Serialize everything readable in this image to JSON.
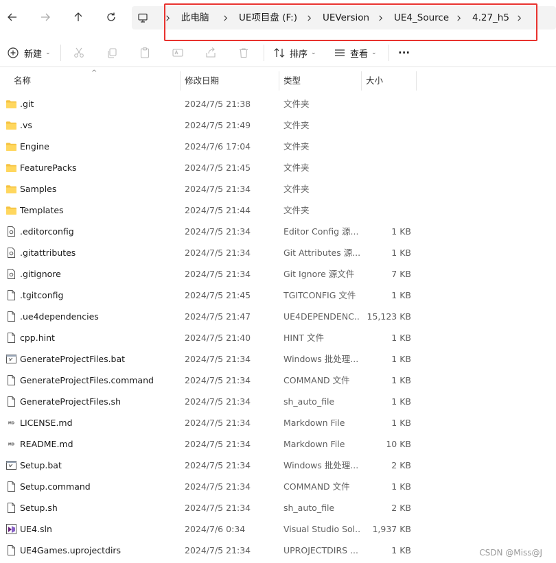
{
  "nav": {
    "back_icon": "arrow-left-icon",
    "forward_icon": "arrow-right-icon",
    "up_icon": "arrow-up-icon",
    "refresh_icon": "refresh-icon",
    "computer_icon": "computer-icon"
  },
  "breadcrumb": [
    "此电脑",
    "UE项目盘 (F:)",
    "UEVersion",
    "UE4_Source",
    "4.27_h5"
  ],
  "toolbar": {
    "new_label": "新建",
    "sort_label": "排序",
    "view_label": "查看",
    "more_label": "···"
  },
  "columns": {
    "name": "名称",
    "date": "修改日期",
    "type": "类型",
    "size": "大小"
  },
  "files": [
    {
      "name": ".git",
      "date": "2024/7/5 21:38",
      "type": "文件夹",
      "size": "",
      "icon": "folder"
    },
    {
      "name": ".vs",
      "date": "2024/7/5 21:49",
      "type": "文件夹",
      "size": "",
      "icon": "folder"
    },
    {
      "name": "Engine",
      "date": "2024/7/6 17:04",
      "type": "文件夹",
      "size": "",
      "icon": "folder"
    },
    {
      "name": "FeaturePacks",
      "date": "2024/7/5 21:45",
      "type": "文件夹",
      "size": "",
      "icon": "folder"
    },
    {
      "name": "Samples",
      "date": "2024/7/5 21:34",
      "type": "文件夹",
      "size": "",
      "icon": "folder"
    },
    {
      "name": "Templates",
      "date": "2024/7/5 21:44",
      "type": "文件夹",
      "size": "",
      "icon": "folder"
    },
    {
      "name": ".editorconfig",
      "date": "2024/7/5 21:34",
      "type": "Editor Config 源...",
      "size": "1 KB",
      "icon": "config"
    },
    {
      "name": ".gitattributes",
      "date": "2024/7/5 21:34",
      "type": "Git Attributes 源...",
      "size": "1 KB",
      "icon": "config"
    },
    {
      "name": ".gitignore",
      "date": "2024/7/5 21:34",
      "type": "Git Ignore 源文件",
      "size": "7 KB",
      "icon": "config"
    },
    {
      "name": ".tgitconfig",
      "date": "2024/7/5 21:45",
      "type": "TGITCONFIG 文件",
      "size": "1 KB",
      "icon": "file"
    },
    {
      "name": ".ue4dependencies",
      "date": "2024/7/5 21:47",
      "type": "UE4DEPENDENC...",
      "size": "15,123 KB",
      "icon": "file"
    },
    {
      "name": "cpp.hint",
      "date": "2024/7/5 21:40",
      "type": "HINT 文件",
      "size": "1 KB",
      "icon": "file"
    },
    {
      "name": "GenerateProjectFiles.bat",
      "date": "2024/7/5 21:34",
      "type": "Windows 批处理...",
      "size": "1 KB",
      "icon": "batch"
    },
    {
      "name": "GenerateProjectFiles.command",
      "date": "2024/7/5 21:34",
      "type": "COMMAND 文件",
      "size": "1 KB",
      "icon": "file"
    },
    {
      "name": "GenerateProjectFiles.sh",
      "date": "2024/7/5 21:34",
      "type": "sh_auto_file",
      "size": "1 KB",
      "icon": "file"
    },
    {
      "name": "LICENSE.md",
      "date": "2024/7/5 21:34",
      "type": "Markdown File",
      "size": "1 KB",
      "icon": "markdown"
    },
    {
      "name": "README.md",
      "date": "2024/7/5 21:34",
      "type": "Markdown File",
      "size": "10 KB",
      "icon": "markdown"
    },
    {
      "name": "Setup.bat",
      "date": "2024/7/5 21:34",
      "type": "Windows 批处理...",
      "size": "2 KB",
      "icon": "batch"
    },
    {
      "name": "Setup.command",
      "date": "2024/7/5 21:34",
      "type": "COMMAND 文件",
      "size": "1 KB",
      "icon": "file"
    },
    {
      "name": "Setup.sh",
      "date": "2024/7/5 21:34",
      "type": "sh_auto_file",
      "size": "2 KB",
      "icon": "file"
    },
    {
      "name": "UE4.sln",
      "date": "2024/7/6 0:34",
      "type": "Visual Studio Sol...",
      "size": "1,937 KB",
      "icon": "sln"
    },
    {
      "name": "UE4Games.uprojectdirs",
      "date": "2024/7/5 21:34",
      "type": "UPROJECTDIRS ...",
      "size": "1 KB",
      "icon": "file"
    }
  ],
  "watermark": "CSDN @Miss@J",
  "colors": {
    "highlight": "#e8322e",
    "folder": "#f5c342",
    "crumb_bg": "#f3f3f3"
  }
}
